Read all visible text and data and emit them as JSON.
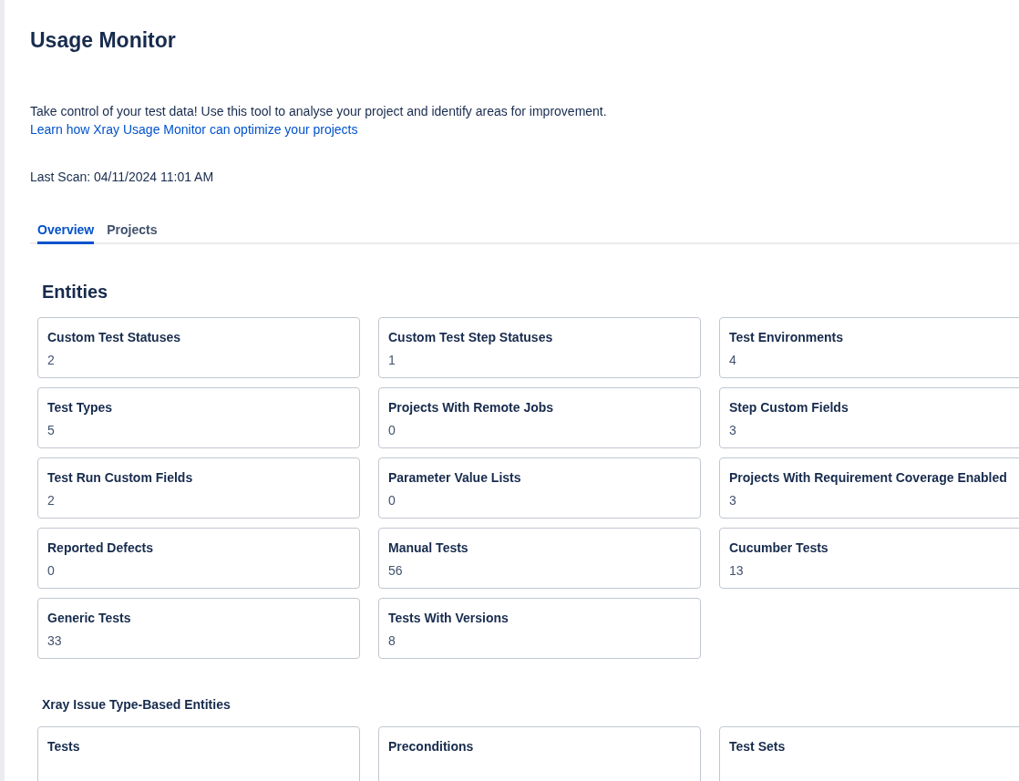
{
  "page": {
    "title": "Usage Monitor",
    "description": "Take control of your test data! Use this tool to analyse your project and identify areas for improvement.",
    "description_link": "Learn how Xray Usage Monitor can optimize your projects",
    "last_scan": "Last Scan: 04/11/2024 11:01 AM"
  },
  "tabs": [
    {
      "label": "Overview",
      "selected": true
    },
    {
      "label": "Projects",
      "selected": false
    }
  ],
  "sections": [
    {
      "title": "Entities",
      "kind": "main",
      "cards": [
        {
          "label": "Custom Test Statuses",
          "value": "2"
        },
        {
          "label": "Custom Test Step Statuses",
          "value": "1"
        },
        {
          "label": "Test Environments",
          "value": "4"
        },
        {
          "label": "Test Types",
          "value": "5"
        },
        {
          "label": "Projects With Remote Jobs",
          "value": "0"
        },
        {
          "label": "Step Custom Fields",
          "value": "3"
        },
        {
          "label": "Test Run Custom Fields",
          "value": "2"
        },
        {
          "label": "Parameter Value Lists",
          "value": "0"
        },
        {
          "label": "Projects With Requirement Coverage Enabled",
          "value": "3"
        },
        {
          "label": "Reported Defects",
          "value": "0"
        },
        {
          "label": "Manual Tests",
          "value": "56"
        },
        {
          "label": "Cucumber Tests",
          "value": "13"
        },
        {
          "label": "Generic Tests",
          "value": "33"
        },
        {
          "label": "Tests With Versions",
          "value": "8"
        }
      ]
    },
    {
      "title": "Xray Issue Type-Based Entities",
      "kind": "sub",
      "cards": [
        {
          "label": "Tests"
        },
        {
          "label": "Preconditions"
        },
        {
          "label": "Test Sets"
        }
      ]
    }
  ]
}
